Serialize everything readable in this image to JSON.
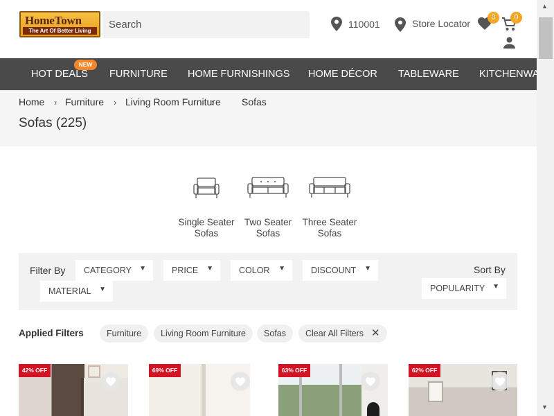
{
  "header": {
    "logo_title": "HomeTown",
    "logo_tagline": "The Art Of Better Living",
    "search_placeholder": "Search",
    "pincode": "110001",
    "store_locator": "Store Locator",
    "wishlist_count": "0",
    "cart_count": "0"
  },
  "nav": {
    "items": [
      "HOT DEALS",
      "FURNITURE",
      "HOME FURNISHINGS",
      "HOME DÉCOR",
      "TABLEWARE",
      "KITCHENWA"
    ],
    "new_tag": "NEW"
  },
  "breadcrumb": [
    "Home",
    "Furniture",
    "Living Room Furniture",
    "Sofas"
  ],
  "page_title": "Sofas (225)",
  "categories": [
    {
      "line1": "Single Seater",
      "line2": "Sofas"
    },
    {
      "line1": "Two Seater",
      "line2": "Sofas"
    },
    {
      "line1": "Three Seater",
      "line2": "Sofas"
    }
  ],
  "filters": {
    "filter_by_label": "Filter By",
    "dropdowns": [
      "CATEGORY",
      "PRICE",
      "COLOR",
      "DISCOUNT",
      "MATERIAL"
    ],
    "sort_by_label": "Sort By",
    "sort_value": "POPULARITY"
  },
  "applied_filters": {
    "label": "Applied Filters",
    "chips": [
      "Furniture",
      "Living Room Furniture",
      "Sofas"
    ],
    "clear_all": "Clear All Filters"
  },
  "products": [
    {
      "discount": "42% OFF"
    },
    {
      "discount": "69% OFF"
    },
    {
      "discount": "63% OFF"
    },
    {
      "discount": "62% OFF"
    }
  ],
  "colors": {
    "nav_bg": "#4a4a4a",
    "accent": "#f5a623",
    "discount_red": "#d21323"
  }
}
